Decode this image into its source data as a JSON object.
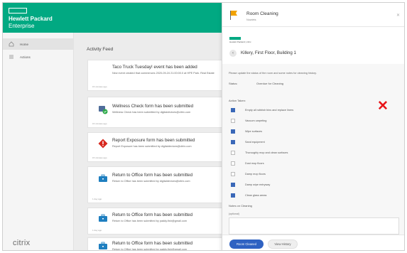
{
  "app": {
    "brand_line1": "Hewlett Packard",
    "brand_line2": "Enterprise",
    "accent_color": "#01a982",
    "footer_logo": "citrix"
  },
  "sidebar": {
    "items": [
      {
        "label": "Home",
        "icon": "home-icon"
      },
      {
        "label": "Actions",
        "icon": "actions-icon"
      }
    ]
  },
  "feed": {
    "title": "Activity Feed",
    "cards": [
      {
        "title": "Taco Truck Tuesday! event has been added",
        "body": "New event created that commences 2020-09-24 21:00:00.0 at HPE Park. Real Estate",
        "time": "15 minutes ago",
        "icon": "calendar-icon"
      },
      {
        "title": "Wellness Check form has been submitted",
        "body": "Wellness Check has been submitted by digitaldevices@citrix.com",
        "time": "15 minutes ago",
        "icon": "wellness-icon"
      },
      {
        "title": "Report Exposure form has been submitted",
        "body": "Report Exposure has been submitted by digitaldevices@citrix.com",
        "time": "15 minutes ago",
        "icon": "alert-icon"
      },
      {
        "title": "Return to Office form has been submitted",
        "body": "Return to Office has been submitted by digitaldevices@citrix.com",
        "time": "1 day ago",
        "icon": "briefcase-icon"
      },
      {
        "title": "Return to Office form has been submitted",
        "body": "Return to Office has been submitted by paddy.fish@gmail.com",
        "time": "1 day ago",
        "icon": "briefcase-icon"
      },
      {
        "title": "Return to Office form has been submitted",
        "body": "Return to Office has been submitted by paddy.fish@gmail.com",
        "time": "",
        "icon": "briefcase-icon"
      }
    ]
  },
  "panel": {
    "title": "Room Cleaning",
    "subtitle": "Nowlets",
    "mini_logo_text": "Hewlett Packard | citrix",
    "location": "Killery, First Floor, Building 1",
    "instruction": "Please update the status of the room and some notes for cleaning history.",
    "status_label": "Status:",
    "status_value": "Overdue for Cleaning",
    "actions_label": "Action Taken:",
    "actions": [
      {
        "label": "Empty all rubbish bins and replace liners",
        "checked": true
      },
      {
        "label": "Vacuum carpeting",
        "checked": false
      },
      {
        "label": "Wipe surfaces",
        "checked": true
      },
      {
        "label": "Sand equipment",
        "checked": true
      },
      {
        "label": "Thoroughly mop and clean surfaces",
        "checked": false
      },
      {
        "label": "Dust mop floors",
        "checked": false
      },
      {
        "label": "Damp mop floors",
        "checked": false
      },
      {
        "label": "Damp wipe entryway",
        "checked": true
      },
      {
        "label": "Clean glass areas",
        "checked": true
      }
    ],
    "notes_label": "Notes on Cleaning",
    "notes_optional": "(optional)",
    "primary_button": "Room Cleaned",
    "secondary_button": "View History",
    "error_mark": "✕",
    "error_color": "#e8151a",
    "button_color": "#2f62c2"
  }
}
